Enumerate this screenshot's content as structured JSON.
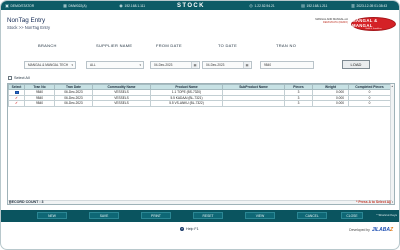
{
  "titlebar": {
    "app": "DEMO/STATOR",
    "code": "DMW022(A)",
    "ip": "192.168.1.111",
    "module": "STOCK",
    "ip2": "1.22.52.94.21",
    "extra": "192.168.1.211",
    "datetime": "2023-12-05 01:38:43"
  },
  "header": {
    "title": "NonTag Entry",
    "breadcrumb": "Stock >> NonTag Entry",
    "company_line": "MANGAL AND MANGAL etc",
    "company_sub": "DEMO/DATA (DEMO)",
    "logo_main": "MANGAL & MANGAL",
    "logo_sub": "Gold & Jewellers"
  },
  "filters": {
    "branch_label": "BRANCH",
    "branch_value": "MANGAL & MANGAL TECH",
    "supplier_label": "SUPPLIER NAME",
    "supplier_value": "ALL",
    "from_label": "FROM DATE",
    "from_value": "04-Dec-2023",
    "to_label": "TO DATE",
    "to_value": "04-Dec-2023",
    "tran_label": "TRAN NO",
    "tran_value": "9840",
    "load_label": "LOAD",
    "select_all_label": "Select All"
  },
  "table": {
    "columns": [
      "Select",
      "Tran No",
      "Tran Date",
      "Commodity Name",
      "Product Name",
      "SubProduct Name",
      "Pieces",
      "Weight",
      "Completed Pieces"
    ],
    "rows": [
      {
        "tran_no": "9840",
        "tran_date": "06-Dec-2023",
        "commodity": "VESSELS",
        "product": "1.1 TOPE (BS-7320)",
        "subproduct": "",
        "pieces": "3",
        "weight": "0.000",
        "completed": "0"
      },
      {
        "tran_no": "9840",
        "tran_date": "06-Dec-2023",
        "commodity": "VESSELS",
        "product": "5.5 KADAAI (BL-7321)",
        "subproduct": "",
        "pieces": "3",
        "weight": "0.000",
        "completed": "0"
      },
      {
        "tran_no": "9840",
        "tran_date": "06-Dec-2023",
        "commodity": "VESSELS",
        "product": "5.5 VS-ANKU (BL-7322)",
        "subproduct": "",
        "pieces": "3",
        "weight": "0.000",
        "completed": "0"
      }
    ]
  },
  "status": {
    "record_count": "RECORD COUNT : 3",
    "hint": "* Press A to Select All"
  },
  "buttons": {
    "b1": "NEW",
    "b2": "SAVE",
    "b3": "PRINT",
    "b4": "RESET",
    "b5": "VIEW",
    "b6": "CANCEL",
    "b7": "CLOSE",
    "shortcut_hint": "* Shortcut Keys"
  },
  "footer": {
    "help": "Help F1",
    "dev_prefix": "Developed by",
    "brand_main": "JILABA",
    "brand_z": "Z"
  },
  "colors": {
    "accent": "#0d5b66",
    "header_row": "#c7e1e4",
    "logo_red": "#d42126",
    "hint_red": "#c0392b"
  }
}
